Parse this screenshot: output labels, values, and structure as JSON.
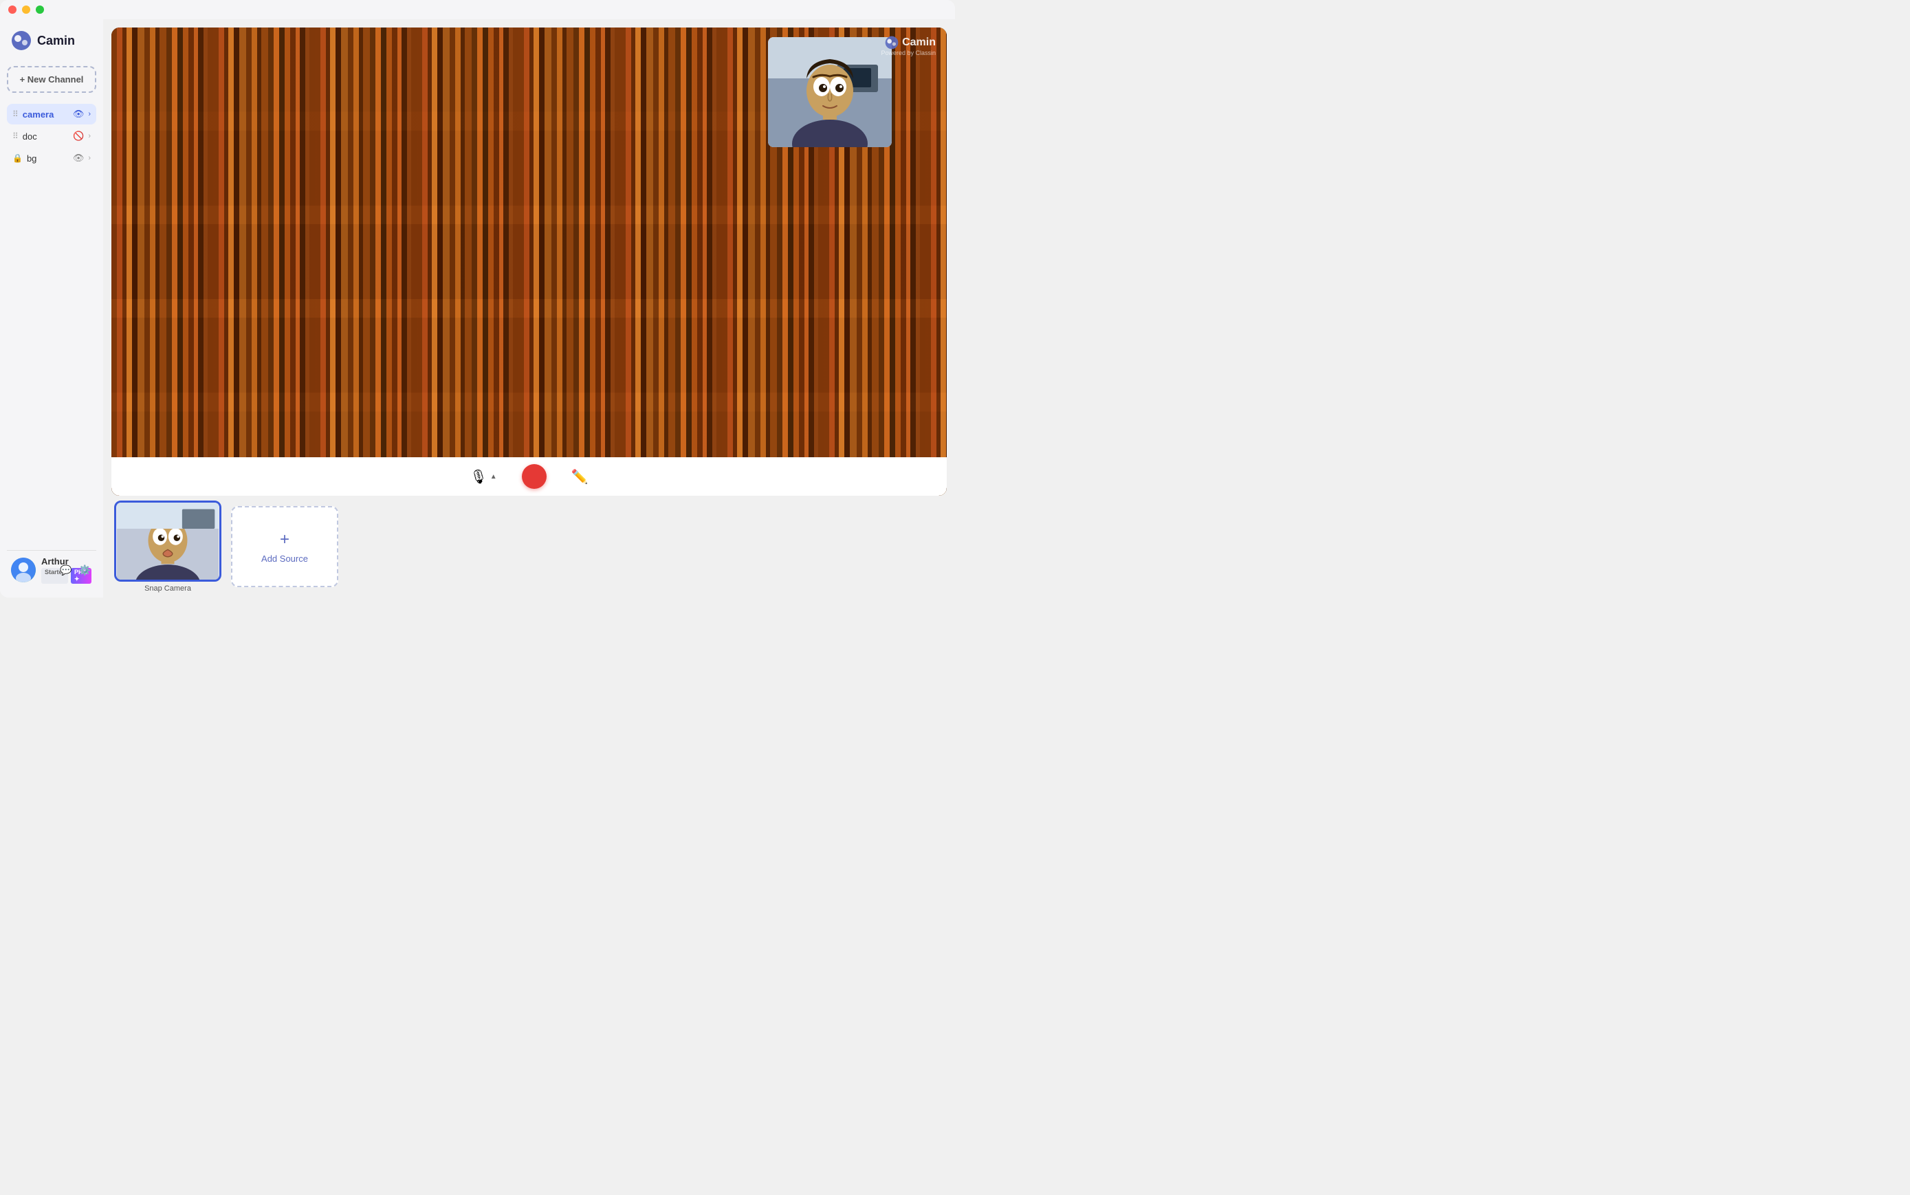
{
  "app": {
    "title": "Camin",
    "logo_text": "Camin"
  },
  "traffic_lights": {
    "close": "close",
    "minimize": "minimize",
    "maximize": "maximize"
  },
  "sidebar": {
    "new_channel_label": "+ New Channel",
    "channels": [
      {
        "id": "camera",
        "name": "camera",
        "active": true,
        "visible": true,
        "locked": false
      },
      {
        "id": "doc",
        "name": "doc",
        "active": false,
        "visible": false,
        "locked": false
      },
      {
        "id": "bg",
        "name": "bg",
        "active": false,
        "visible": true,
        "locked": true
      }
    ]
  },
  "user": {
    "name": "Arthur",
    "badge_starter": "Starter",
    "badge_pro": "PRO ✦"
  },
  "watermark": {
    "text": "Camin",
    "subtext": "Powered by Classin"
  },
  "controls": {
    "mic_label": "mic",
    "record_label": "record",
    "pen_label": "pen"
  },
  "sources": [
    {
      "label": "Snap Camera"
    }
  ],
  "add_source": {
    "label": "Add Source",
    "plus": "+"
  }
}
